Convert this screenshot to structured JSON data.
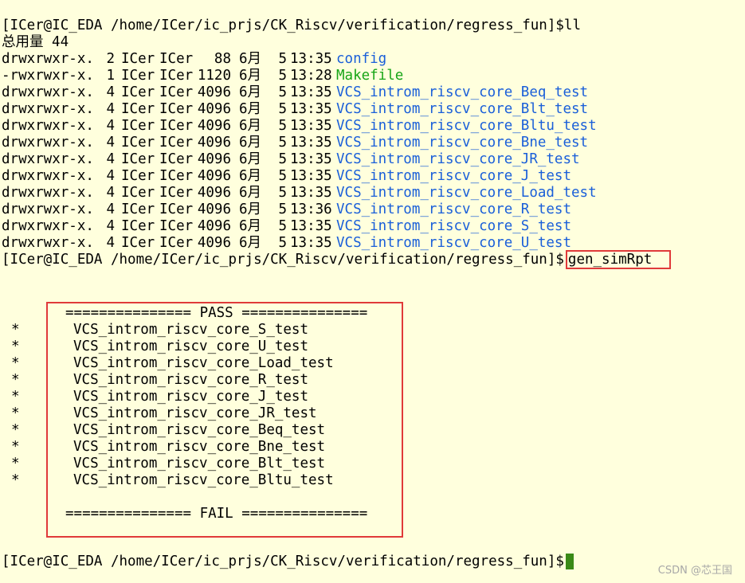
{
  "prompt1": "[ICer@IC_EDA /home/ICer/ic_prjs/CK_Riscv/verification/regress_fun]$",
  "cmd1": "ll",
  "total": "总用量 44",
  "listing": [
    {
      "perm": "drwxrwxr-x.",
      "links": "2",
      "user": "ICer",
      "group": "ICer",
      "size": "88",
      "month": "6月",
      "day": "5",
      "time": "13:35",
      "name": "config",
      "color": "blue"
    },
    {
      "perm": "-rwxrwxr-x.",
      "links": "1",
      "user": "ICer",
      "group": "ICer",
      "size": "1120",
      "month": "6月",
      "day": "5",
      "time": "13:28",
      "name": "Makefile",
      "color": "green"
    },
    {
      "perm": "drwxrwxr-x.",
      "links": "4",
      "user": "ICer",
      "group": "ICer",
      "size": "4096",
      "month": "6月",
      "day": "5",
      "time": "13:35",
      "name": "VCS_introm_riscv_core_Beq_test",
      "color": "blue"
    },
    {
      "perm": "drwxrwxr-x.",
      "links": "4",
      "user": "ICer",
      "group": "ICer",
      "size": "4096",
      "month": "6月",
      "day": "5",
      "time": "13:35",
      "name": "VCS_introm_riscv_core_Blt_test",
      "color": "blue"
    },
    {
      "perm": "drwxrwxr-x.",
      "links": "4",
      "user": "ICer",
      "group": "ICer",
      "size": "4096",
      "month": "6月",
      "day": "5",
      "time": "13:35",
      "name": "VCS_introm_riscv_core_Bltu_test",
      "color": "blue"
    },
    {
      "perm": "drwxrwxr-x.",
      "links": "4",
      "user": "ICer",
      "group": "ICer",
      "size": "4096",
      "month": "6月",
      "day": "5",
      "time": "13:35",
      "name": "VCS_introm_riscv_core_Bne_test",
      "color": "blue"
    },
    {
      "perm": "drwxrwxr-x.",
      "links": "4",
      "user": "ICer",
      "group": "ICer",
      "size": "4096",
      "month": "6月",
      "day": "5",
      "time": "13:35",
      "name": "VCS_introm_riscv_core_JR_test",
      "color": "blue"
    },
    {
      "perm": "drwxrwxr-x.",
      "links": "4",
      "user": "ICer",
      "group": "ICer",
      "size": "4096",
      "month": "6月",
      "day": "5",
      "time": "13:35",
      "name": "VCS_introm_riscv_core_J_test",
      "color": "blue"
    },
    {
      "perm": "drwxrwxr-x.",
      "links": "4",
      "user": "ICer",
      "group": "ICer",
      "size": "4096",
      "month": "6月",
      "day": "5",
      "time": "13:35",
      "name": "VCS_introm_riscv_core_Load_test",
      "color": "blue"
    },
    {
      "perm": "drwxrwxr-x.",
      "links": "4",
      "user": "ICer",
      "group": "ICer",
      "size": "4096",
      "month": "6月",
      "day": "5",
      "time": "13:36",
      "name": "VCS_introm_riscv_core_R_test",
      "color": "blue"
    },
    {
      "perm": "drwxrwxr-x.",
      "links": "4",
      "user": "ICer",
      "group": "ICer",
      "size": "4096",
      "month": "6月",
      "day": "5",
      "time": "13:35",
      "name": "VCS_introm_riscv_core_S_test",
      "color": "blue"
    },
    {
      "perm": "drwxrwxr-x.",
      "links": "4",
      "user": "ICer",
      "group": "ICer",
      "size": "4096",
      "month": "6月",
      "day": "5",
      "time": "13:35",
      "name": "VCS_introm_riscv_core_U_test",
      "color": "blue"
    }
  ],
  "prompt2": "[ICer@IC_EDA /home/ICer/ic_prjs/CK_Riscv/verification/regress_fun]$",
  "cmd2": "gen_simRpt",
  "report": {
    "pass_header": "=============== PASS ===============",
    "star": "*",
    "pass_items": [
      "VCS_introm_riscv_core_S_test",
      "VCS_introm_riscv_core_U_test",
      "VCS_introm_riscv_core_Load_test",
      "VCS_introm_riscv_core_R_test",
      "VCS_introm_riscv_core_J_test",
      "VCS_introm_riscv_core_JR_test",
      "VCS_introm_riscv_core_Beq_test",
      "VCS_introm_riscv_core_Bne_test",
      "VCS_introm_riscv_core_Blt_test",
      "VCS_introm_riscv_core_Bltu_test"
    ],
    "fail_header": "=============== FAIL ==============="
  },
  "prompt3": "[ICer@IC_EDA /home/ICer/ic_prjs/CK_Riscv/verification/regress_fun]$",
  "watermark": "CSDN @芯王国",
  "colors": {
    "background": "#ffffdd",
    "dir": "#1a5fd9",
    "exec": "#17a517",
    "highlight": "#e03a3a",
    "cursor": "#3a8a17"
  }
}
